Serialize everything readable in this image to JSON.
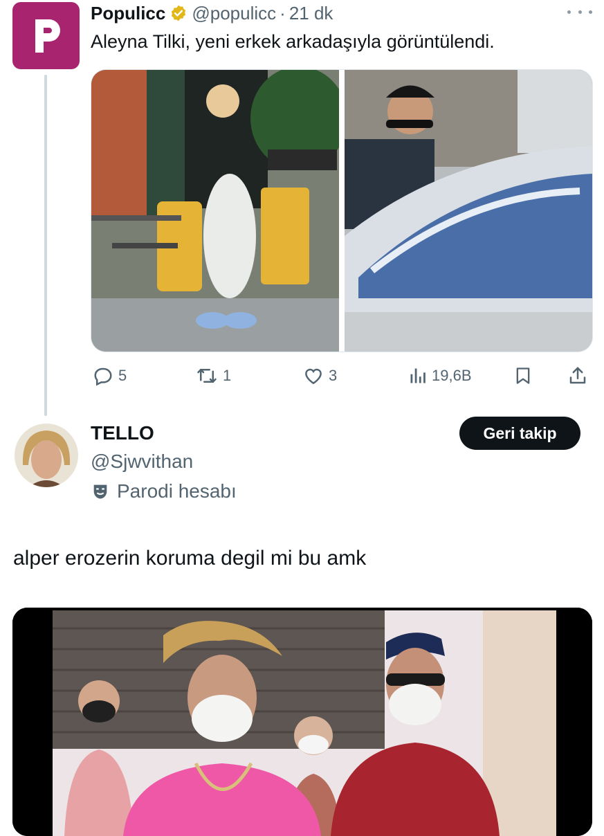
{
  "parent_tweet": {
    "author_name": "Populicc",
    "handle": "@populicc",
    "separator": "·",
    "time": "21 dk",
    "text": "Aleyna Tilki, yeni erkek arkadaşıyla görüntülendi.",
    "avatar_letter": "P",
    "avatar_color": "#a9246f",
    "verified_badge": "gold-verified-icon",
    "actions": {
      "replies": "5",
      "retweets": "1",
      "likes": "3",
      "views": "19,6B"
    }
  },
  "reply": {
    "author_name": "TELLO",
    "handle": "@Sjwvithan",
    "parody_label": "Parodi hesabı",
    "follow_button": "Geri takip",
    "text": "alper erozerin koruma degil mi bu amk"
  },
  "colors": {
    "text_primary": "#0f1419",
    "text_secondary": "#536471",
    "thread_line": "#cfd9de",
    "verified_gold": "#e2b719"
  }
}
